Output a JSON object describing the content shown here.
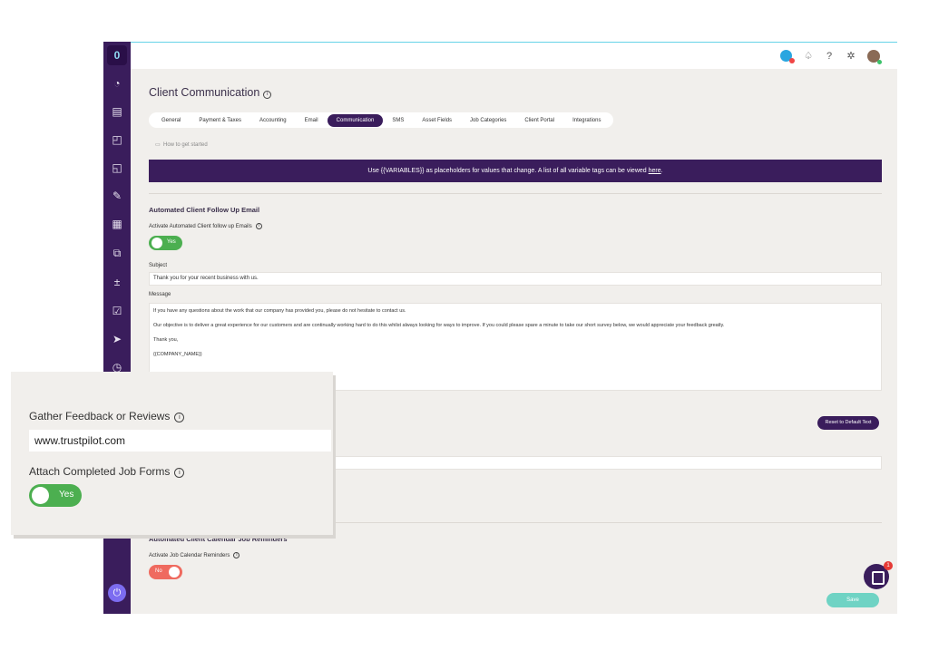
{
  "sidebar": {
    "logo": "0",
    "icons": [
      "speedometer-icon",
      "building-icon",
      "briefcase-clock-icon",
      "briefcase-plus-icon",
      "wrench-icon",
      "receipt-icon",
      "clipboard-swap-icon",
      "calculator-icon",
      "checklist-icon",
      "send-icon",
      "stopwatch-icon"
    ],
    "power": "⏻"
  },
  "topbar": {
    "icons": [
      "bell-icon",
      "help-icon",
      "settings-icon"
    ]
  },
  "page": {
    "title": "Client Communication"
  },
  "tabs": [
    "General",
    "Payment & Taxes",
    "Accounting",
    "Email",
    "Communication",
    "SMS",
    "Asset Fields",
    "Job Categories",
    "Client Portal",
    "Integrations"
  ],
  "active_tab": "Communication",
  "howto": "How to get started",
  "banner": {
    "text": "Use {{VARIABLES}} as placeholders for values that change. A list of all variable tags can be viewed ",
    "link": "here",
    "end": "."
  },
  "followup": {
    "title": "Automated Client Follow Up Email",
    "activate_label": "Activate Automated Client follow up Emails",
    "toggle": "Yes",
    "subject_label": "Subject",
    "subject_value": "Thank you for your recent business with us.",
    "message_label": "Message",
    "message": [
      "If you have any questions about the work that our company has provided you, please do not hesitate to contact us.",
      "Our objective is to deliver a great experience for our customers and are continually working hard to do this whilst always looking for ways to improve. If you could please spare a minute to take our short survey below, we would appreciate your feedback greatly.",
      "Thank you,",
      "{{COMPANY_NAME}}"
    ],
    "reset_label": "Reset to Default Text"
  },
  "reminders": {
    "title": "Automated Client Calendar Job Reminders",
    "activate_label": "Activate Job Calendar Reminders",
    "toggle": "No"
  },
  "save_label": "Save",
  "chat_badge": "1",
  "card": {
    "feedback_label": "Gather Feedback or Reviews",
    "feedback_value": "www.trustpilot.com",
    "attach_label": "Attach Completed Job Forms",
    "toggle": "Yes"
  }
}
